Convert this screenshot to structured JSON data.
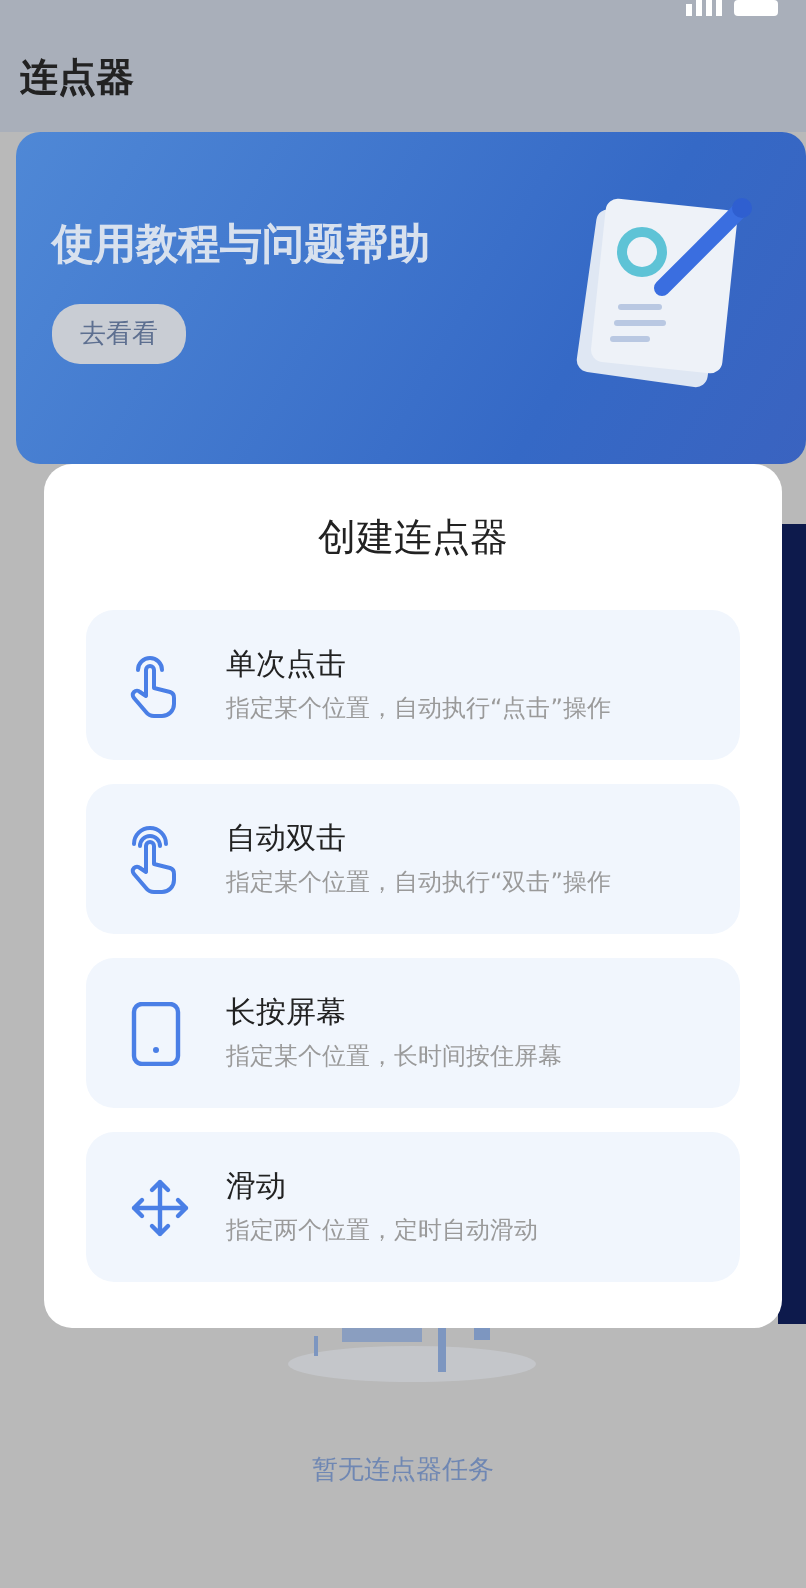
{
  "page_title": "连点器",
  "banner": {
    "title": "使用教程与问题帮助",
    "button": "去看看"
  },
  "empty_state": {
    "text": "暂无连点器任务"
  },
  "dialog": {
    "title": "创建连点器",
    "options": [
      {
        "kind": "single-tap",
        "title": "单次点击",
        "description": "指定某个位置，自动执行“点击”操作"
      },
      {
        "kind": "double-tap",
        "title": "自动双击",
        "description": "指定某个位置，自动执行“双击”操作"
      },
      {
        "kind": "long-press",
        "title": "长按屏幕",
        "description": "指定某个位置，长时间按住屏幕"
      },
      {
        "kind": "swipe",
        "title": "滑动",
        "description": "指定两个位置，定时自动滑动"
      }
    ]
  }
}
